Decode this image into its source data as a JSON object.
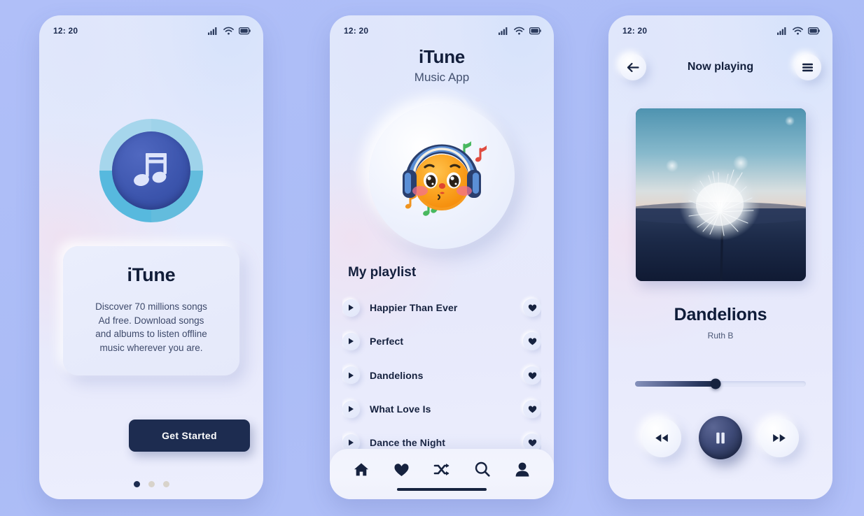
{
  "status_bar": {
    "time": "12: 20",
    "icons": [
      "signal-icon",
      "wifi-icon",
      "battery-icon"
    ]
  },
  "screen_onboarding": {
    "logo_icon": "music-note-logo-icon",
    "card": {
      "title": "iTune",
      "description_lines": [
        "Discover 70 millions songs",
        "Ad free. Download songs",
        "and albums to listen offline",
        "music wherever you are."
      ]
    },
    "cta_label": "Get Started",
    "pagination": {
      "total": 3,
      "active_index": 0
    },
    "colors": {
      "cta_bg": "#1d2c50",
      "dot_active": "#1d2c50",
      "dot_inactive": "#d8d3cb"
    }
  },
  "screen_playlist": {
    "title": "iTune",
    "subtitle": "Music App",
    "avatar_icon": "emoji-headphones-avatar-icon",
    "section_title": "My playlist",
    "tracks": [
      {
        "name": "Happier Than Ever",
        "play_icon": "play-icon",
        "favorite_icon": "heart-icon"
      },
      {
        "name": "Perfect",
        "play_icon": "play-icon",
        "favorite_icon": "heart-icon"
      },
      {
        "name": "Dandelions",
        "play_icon": "play-icon",
        "favorite_icon": "heart-icon"
      },
      {
        "name": "What Love Is",
        "play_icon": "play-icon",
        "favorite_icon": "heart-icon"
      },
      {
        "name": "Dance the Night",
        "play_icon": "play-icon",
        "favorite_icon": "heart-icon"
      }
    ],
    "tabs": [
      {
        "name": "home",
        "icon": "home-icon"
      },
      {
        "name": "favorites",
        "icon": "heart-icon"
      },
      {
        "name": "shuffle",
        "icon": "shuffle-icon"
      },
      {
        "name": "search",
        "icon": "search-icon"
      },
      {
        "name": "profile",
        "icon": "person-icon"
      }
    ]
  },
  "screen_now_playing": {
    "header_title": "Now playing",
    "back_icon": "arrow-left-icon",
    "menu_icon": "hamburger-menu-icon",
    "album_art": "dandelion-sunset-photo",
    "song_title": "Dandelions",
    "artist": "Ruth B",
    "progress_percent": 47,
    "controls": [
      {
        "name": "rewind",
        "icon": "rewind-icon"
      },
      {
        "name": "pause",
        "icon": "pause-icon"
      },
      {
        "name": "forward",
        "icon": "fast-forward-icon"
      }
    ],
    "colors": {
      "play_button": "#2a3557",
      "progress_fill": "#1b2747"
    }
  }
}
